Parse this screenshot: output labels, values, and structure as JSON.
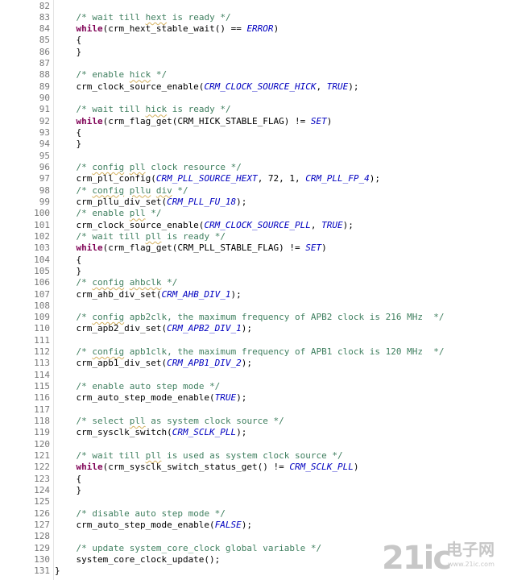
{
  "lines": [
    {
      "n": "82",
      "t": [
        [
          "p",
          ""
        ]
      ]
    },
    {
      "n": "83",
      "t": [
        [
          "p",
          "    "
        ],
        [
          "c",
          "/* wait till "
        ],
        [
          "cs",
          "hext"
        ],
        [
          "c",
          " is ready */"
        ]
      ]
    },
    {
      "n": "84",
      "t": [
        [
          "p",
          "    "
        ],
        [
          "k",
          "while"
        ],
        [
          "p",
          "(crm_hext_stable_wait() == "
        ],
        [
          "i",
          "ERROR"
        ],
        [
          "p",
          ")"
        ]
      ]
    },
    {
      "n": "85",
      "t": [
        [
          "p",
          "    {"
        ]
      ]
    },
    {
      "n": "86",
      "t": [
        [
          "p",
          "    }"
        ]
      ]
    },
    {
      "n": "87",
      "t": [
        [
          "p",
          ""
        ]
      ]
    },
    {
      "n": "88",
      "t": [
        [
          "p",
          "    "
        ],
        [
          "c",
          "/* enable "
        ],
        [
          "cs",
          "hick"
        ],
        [
          "c",
          " */"
        ]
      ]
    },
    {
      "n": "89",
      "t": [
        [
          "p",
          "    crm_clock_source_enable("
        ],
        [
          "i",
          "CRM_CLOCK_SOURCE_HICK"
        ],
        [
          "p",
          ", "
        ],
        [
          "i",
          "TRUE"
        ],
        [
          "p",
          ");"
        ]
      ]
    },
    {
      "n": "90",
      "t": [
        [
          "p",
          ""
        ]
      ]
    },
    {
      "n": "91",
      "t": [
        [
          "p",
          "    "
        ],
        [
          "c",
          "/* wait till "
        ],
        [
          "cs",
          "hick"
        ],
        [
          "c",
          " is ready */"
        ]
      ]
    },
    {
      "n": "92",
      "t": [
        [
          "p",
          "    "
        ],
        [
          "k",
          "while"
        ],
        [
          "p",
          "(crm_flag_get(CRM_HICK_STABLE_FLAG) != "
        ],
        [
          "i",
          "SET"
        ],
        [
          "p",
          ")"
        ]
      ]
    },
    {
      "n": "93",
      "t": [
        [
          "p",
          "    {"
        ]
      ]
    },
    {
      "n": "94",
      "t": [
        [
          "p",
          "    }"
        ]
      ]
    },
    {
      "n": "95",
      "t": [
        [
          "p",
          ""
        ]
      ]
    },
    {
      "n": "96",
      "t": [
        [
          "p",
          "    "
        ],
        [
          "c",
          "/* "
        ],
        [
          "cs",
          "config"
        ],
        [
          "c",
          " "
        ],
        [
          "cs",
          "pll"
        ],
        [
          "c",
          " clock resource */"
        ]
      ]
    },
    {
      "n": "97",
      "t": [
        [
          "p",
          "    crm_pll_config("
        ],
        [
          "i",
          "CRM_PLL_SOURCE_HEXT"
        ],
        [
          "p",
          ", 72, 1, "
        ],
        [
          "i",
          "CRM_PLL_FP_4"
        ],
        [
          "p",
          ");"
        ]
      ]
    },
    {
      "n": "98",
      "t": [
        [
          "p",
          "    "
        ],
        [
          "c",
          "/* "
        ],
        [
          "cs",
          "config"
        ],
        [
          "c",
          " "
        ],
        [
          "cs",
          "pllu"
        ],
        [
          "c",
          " "
        ],
        [
          "cs",
          "div"
        ],
        [
          "c",
          " */"
        ]
      ]
    },
    {
      "n": "99",
      "t": [
        [
          "p",
          "    crm_pllu_div_set("
        ],
        [
          "i",
          "CRM_PLL_FU_18"
        ],
        [
          "p",
          ");"
        ]
      ]
    },
    {
      "n": "100",
      "t": [
        [
          "p",
          "    "
        ],
        [
          "c",
          "/* enable "
        ],
        [
          "cs",
          "pll"
        ],
        [
          "c",
          " */"
        ]
      ]
    },
    {
      "n": "101",
      "t": [
        [
          "p",
          "    crm_clock_source_enable("
        ],
        [
          "i",
          "CRM_CLOCK_SOURCE_PLL"
        ],
        [
          "p",
          ", "
        ],
        [
          "i",
          "TRUE"
        ],
        [
          "p",
          ");"
        ]
      ]
    },
    {
      "n": "102",
      "t": [
        [
          "p",
          "    "
        ],
        [
          "c",
          "/* wait till "
        ],
        [
          "cs",
          "pll"
        ],
        [
          "c",
          " is ready */"
        ]
      ]
    },
    {
      "n": "103",
      "t": [
        [
          "p",
          "    "
        ],
        [
          "k",
          "while"
        ],
        [
          "p",
          "(crm_flag_get(CRM_PLL_STABLE_FLAG) != "
        ],
        [
          "i",
          "SET"
        ],
        [
          "p",
          ")"
        ]
      ]
    },
    {
      "n": "104",
      "t": [
        [
          "p",
          "    {"
        ]
      ]
    },
    {
      "n": "105",
      "t": [
        [
          "p",
          "    }"
        ]
      ]
    },
    {
      "n": "106",
      "t": [
        [
          "p",
          "    "
        ],
        [
          "c",
          "/* "
        ],
        [
          "cs",
          "config"
        ],
        [
          "c",
          " "
        ],
        [
          "cs",
          "ahbclk"
        ],
        [
          "c",
          " */"
        ]
      ]
    },
    {
      "n": "107",
      "t": [
        [
          "p",
          "    crm_ahb_div_set("
        ],
        [
          "i",
          "CRM_AHB_DIV_1"
        ],
        [
          "p",
          ");"
        ]
      ]
    },
    {
      "n": "108",
      "t": [
        [
          "p",
          ""
        ]
      ]
    },
    {
      "n": "109",
      "t": [
        [
          "p",
          "    "
        ],
        [
          "c",
          "/* "
        ],
        [
          "cs",
          "config"
        ],
        [
          "c",
          " apb2clk, the maximum frequency of APB2 clock is 216 MHz  */"
        ]
      ]
    },
    {
      "n": "110",
      "t": [
        [
          "p",
          "    crm_apb2_div_set("
        ],
        [
          "i",
          "CRM_APB2_DIV_1"
        ],
        [
          "p",
          ");"
        ]
      ]
    },
    {
      "n": "111",
      "t": [
        [
          "p",
          ""
        ]
      ]
    },
    {
      "n": "112",
      "t": [
        [
          "p",
          "    "
        ],
        [
          "c",
          "/* "
        ],
        [
          "cs",
          "config"
        ],
        [
          "c",
          " apb1clk, the maximum frequency of APB1 clock is 120 MHz  */"
        ]
      ]
    },
    {
      "n": "113",
      "t": [
        [
          "p",
          "    crm_apb1_div_set("
        ],
        [
          "i",
          "CRM_APB1_DIV_2"
        ],
        [
          "p",
          ");"
        ]
      ]
    },
    {
      "n": "114",
      "t": [
        [
          "p",
          ""
        ]
      ]
    },
    {
      "n": "115",
      "t": [
        [
          "p",
          "    "
        ],
        [
          "c",
          "/* enable auto step mode */"
        ]
      ]
    },
    {
      "n": "116",
      "t": [
        [
          "p",
          "    crm_auto_step_mode_enable("
        ],
        [
          "i",
          "TRUE"
        ],
        [
          "p",
          ");"
        ]
      ]
    },
    {
      "n": "117",
      "t": [
        [
          "p",
          ""
        ]
      ]
    },
    {
      "n": "118",
      "t": [
        [
          "p",
          "    "
        ],
        [
          "c",
          "/* select "
        ],
        [
          "cs",
          "pll"
        ],
        [
          "c",
          " as system clock source */"
        ]
      ]
    },
    {
      "n": "119",
      "t": [
        [
          "p",
          "    crm_sysclk_switch("
        ],
        [
          "i",
          "CRM_SCLK_PLL"
        ],
        [
          "p",
          ");"
        ]
      ]
    },
    {
      "n": "120",
      "t": [
        [
          "p",
          ""
        ]
      ]
    },
    {
      "n": "121",
      "t": [
        [
          "p",
          "    "
        ],
        [
          "c",
          "/* wait till "
        ],
        [
          "cs",
          "pll"
        ],
        [
          "c",
          " is used as system clock source */"
        ]
      ]
    },
    {
      "n": "122",
      "t": [
        [
          "p",
          "    "
        ],
        [
          "k",
          "while"
        ],
        [
          "p",
          "(crm_sysclk_switch_status_get() != "
        ],
        [
          "i",
          "CRM_SCLK_PLL"
        ],
        [
          "p",
          ")"
        ]
      ]
    },
    {
      "n": "123",
      "t": [
        [
          "p",
          "    {"
        ]
      ]
    },
    {
      "n": "124",
      "t": [
        [
          "p",
          "    }"
        ]
      ]
    },
    {
      "n": "125",
      "t": [
        [
          "p",
          ""
        ]
      ]
    },
    {
      "n": "126",
      "t": [
        [
          "p",
          "    "
        ],
        [
          "c",
          "/* disable auto step mode */"
        ]
      ]
    },
    {
      "n": "127",
      "t": [
        [
          "p",
          "    crm_auto_step_mode_enable("
        ],
        [
          "i",
          "FALSE"
        ],
        [
          "p",
          ");"
        ]
      ]
    },
    {
      "n": "128",
      "t": [
        [
          "p",
          ""
        ]
      ]
    },
    {
      "n": "129",
      "t": [
        [
          "p",
          "    "
        ],
        [
          "c",
          "/* update system_core_clock global variable */"
        ]
      ]
    },
    {
      "n": "130",
      "t": [
        [
          "p",
          "    system_core_clock_update();"
        ]
      ]
    },
    {
      "n": "131",
      "t": [
        [
          "p",
          "}"
        ]
      ]
    }
  ],
  "watermark": {
    "number": "21ic",
    "cn": "电子网",
    "sub": "www.21ic.com"
  },
  "colors": {
    "comment": "#3f7f5f",
    "keyword": "#7f0055",
    "constant": "#0000c0",
    "line_number": "#787878"
  }
}
